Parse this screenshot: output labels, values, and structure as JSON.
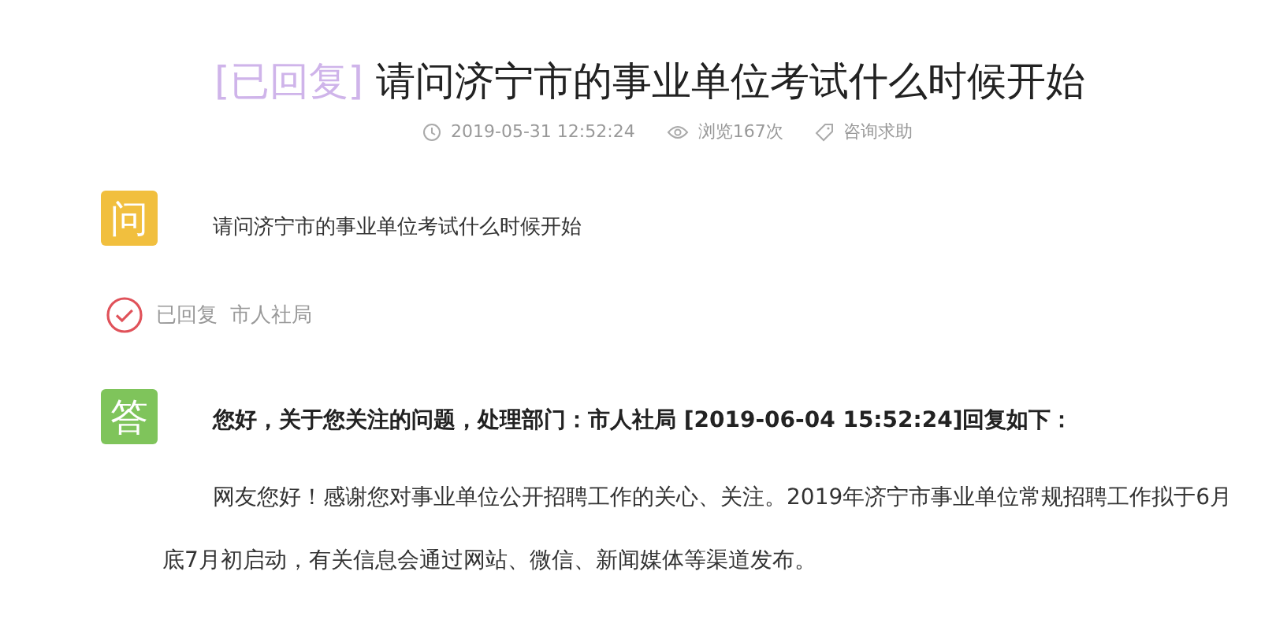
{
  "title": {
    "status": "[已回复]",
    "text": "请问济宁市的事业单位考试什么时候开始"
  },
  "meta": [
    {
      "kind": "time",
      "text": "2019-05-31 12:52:24"
    },
    {
      "kind": "views",
      "text": "浏览167次"
    },
    {
      "kind": "category",
      "text": "咨询求助"
    }
  ],
  "question": {
    "badge": "问",
    "text": "请问济宁市的事业单位考试什么时候开始"
  },
  "reply_status": {
    "state": "已回复",
    "department": "市人社局"
  },
  "answer": {
    "badge": "答",
    "heading": "您好，关于您关注的问题，处理部门：市人社局 [2019-06-04 15:52:24]回复如下：",
    "body": "网友您好！感谢您对事业单位公开招聘工作的关心、关注。2019年济宁市事业单位常规招聘工作拟于6月底7月初启动，有关信息会通过网站、微信、新闻媒体等渠道发布。"
  }
}
